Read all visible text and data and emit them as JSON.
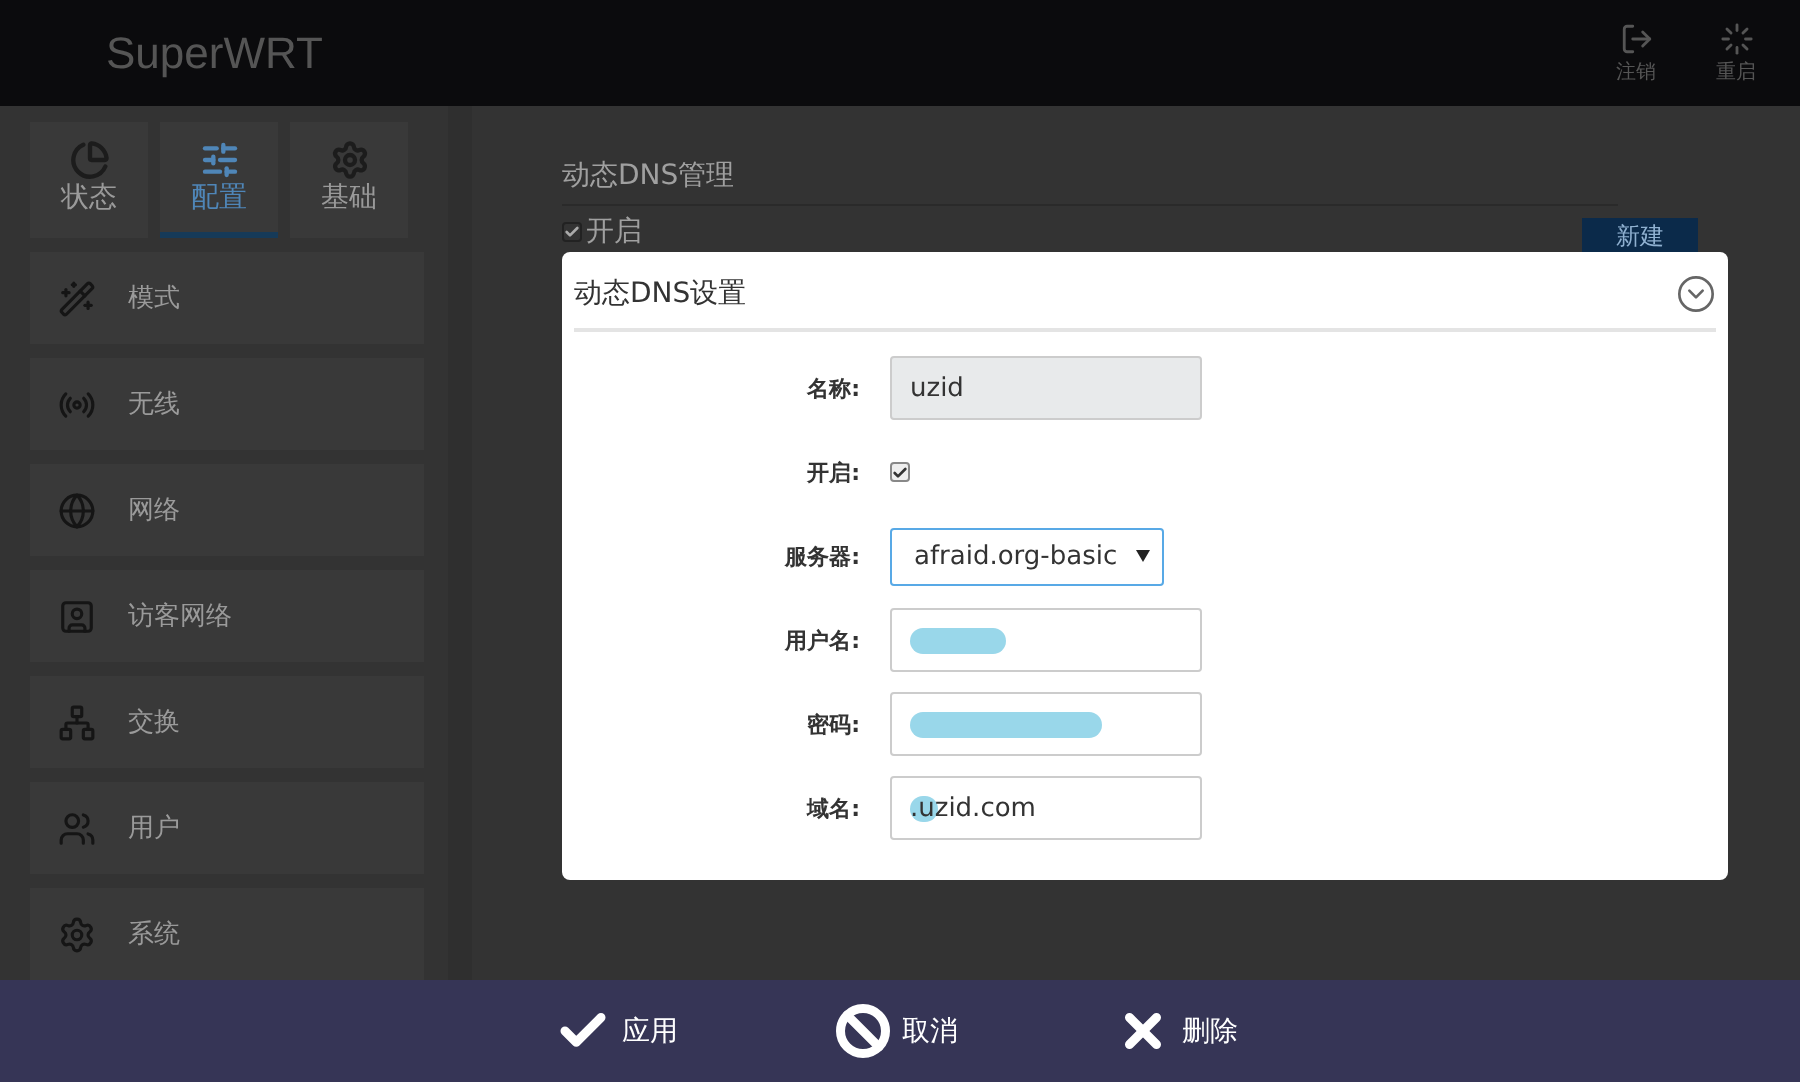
{
  "app": {
    "title": "SuperWRT"
  },
  "header_actions": [
    {
      "label": "注销",
      "kind": "logout"
    },
    {
      "label": "重启",
      "kind": "reboot"
    }
  ],
  "tabs": [
    {
      "label": "状态",
      "kind": "status",
      "selected": false
    },
    {
      "label": "配置",
      "kind": "config",
      "selected": true
    },
    {
      "label": "基础",
      "kind": "basic",
      "selected": false
    }
  ],
  "sidebar": {
    "items": [
      {
        "label": "模式",
        "kind": "mode"
      },
      {
        "label": "无线",
        "kind": "wireless"
      },
      {
        "label": "网络",
        "kind": "network"
      },
      {
        "label": "访客网络",
        "kind": "guest"
      },
      {
        "label": "交换",
        "kind": "switch"
      },
      {
        "label": "用户",
        "kind": "users"
      },
      {
        "label": "系统",
        "kind": "system"
      }
    ]
  },
  "content": {
    "title": "动态DNS管理",
    "enabled_label": "开启",
    "enabled": true,
    "new_button": "新建"
  },
  "dialog": {
    "title": "动态DNS设置",
    "fields": [
      {
        "kind": "text",
        "label": "名称:",
        "value": "uzid",
        "disabled": true
      },
      {
        "kind": "checkbox",
        "label": "开启:",
        "checked": true
      },
      {
        "kind": "select",
        "label": "服务器:",
        "value": "afraid.org-basic"
      },
      {
        "kind": "text",
        "label": "用户名:",
        "redacted": true
      },
      {
        "kind": "password",
        "label": "密码:",
        "redacted": true
      },
      {
        "kind": "text",
        "label": "域名:",
        "value": ".uzid.com",
        "redacted": true
      }
    ]
  },
  "footer": {
    "buttons": [
      {
        "label": "应用",
        "kind": "apply"
      },
      {
        "label": "取消",
        "kind": "cancel"
      },
      {
        "label": "删除",
        "kind": "delete"
      }
    ]
  }
}
